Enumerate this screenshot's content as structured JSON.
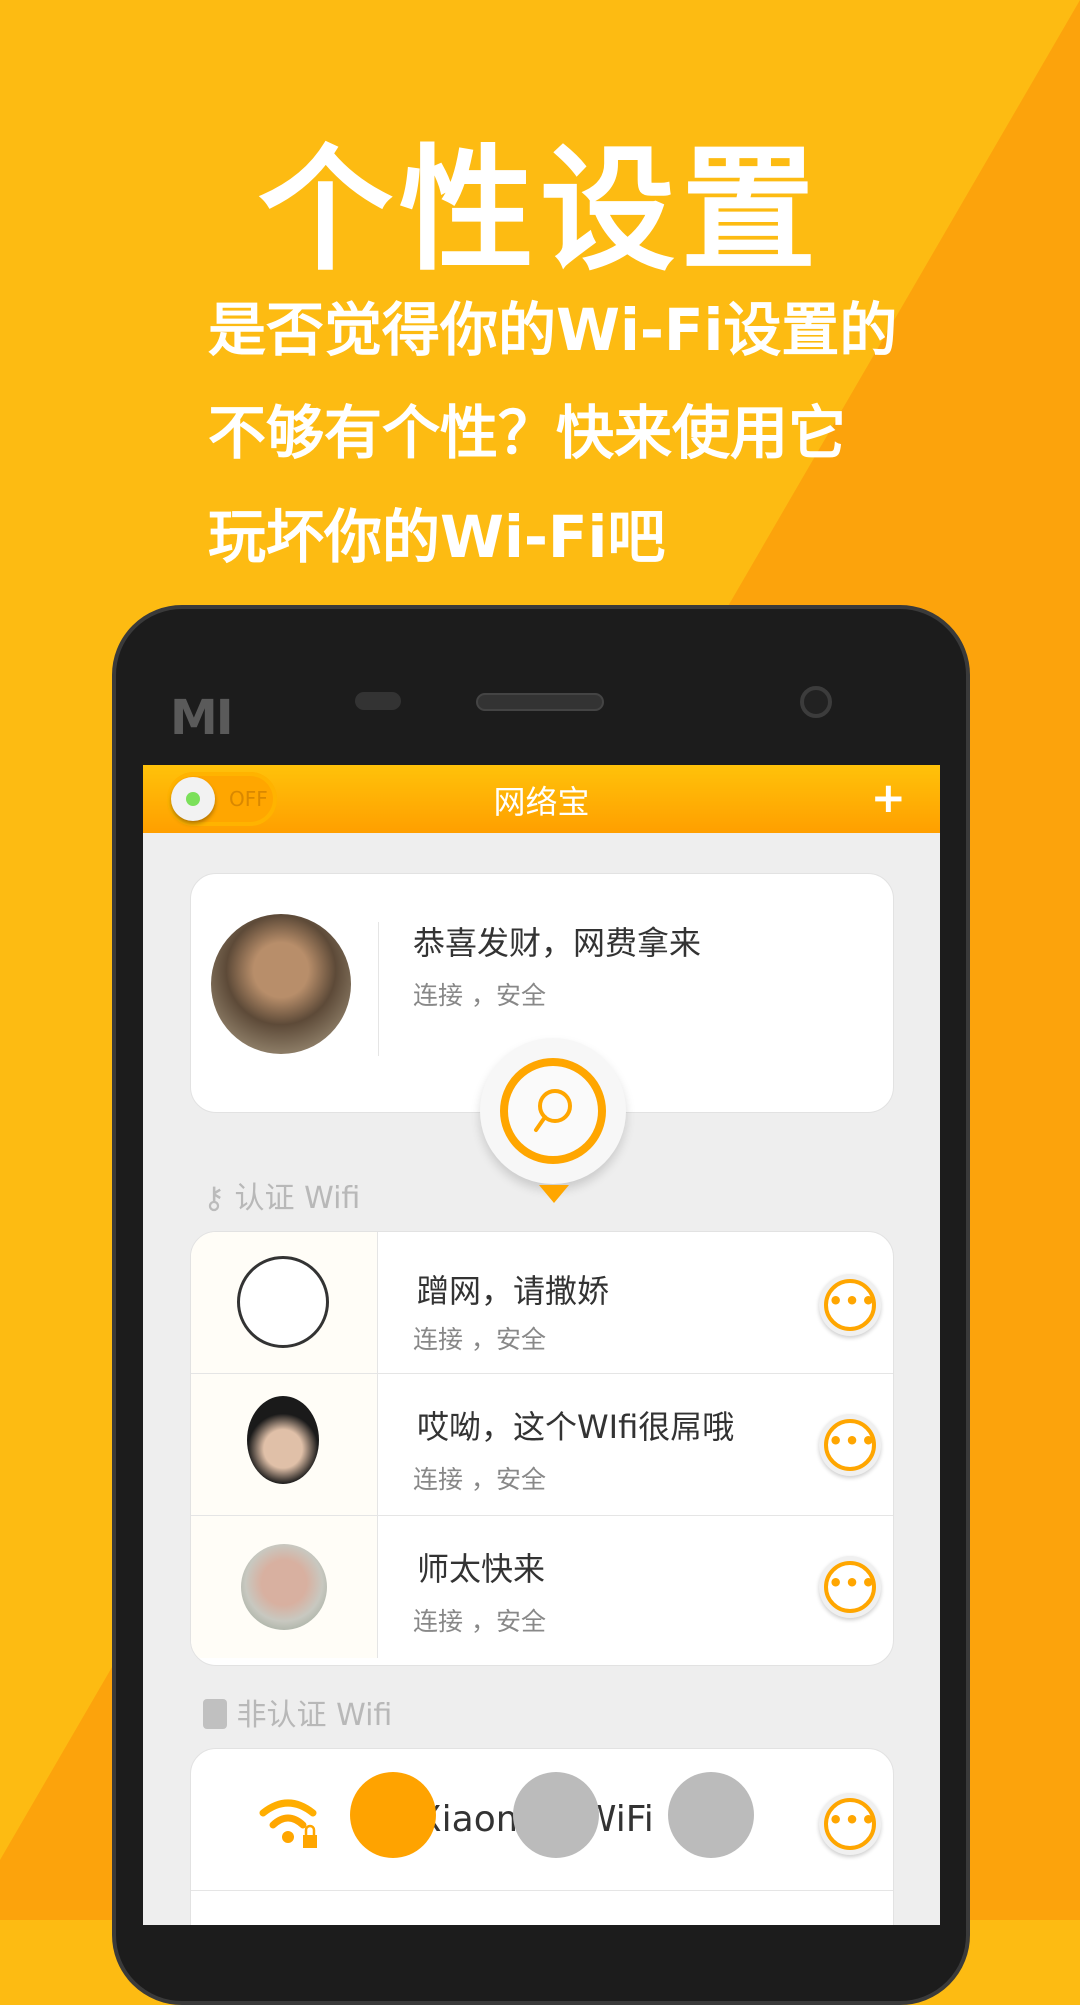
{
  "promo": {
    "headline": "个性设置",
    "lines": [
      "是否觉得你的Wi-Fi设置的",
      "不够有个性？快来使用它",
      "玩坏你的Wi-Fi吧"
    ]
  },
  "colors": {
    "background_yellow": "#fdbb12",
    "background_orange": "#fca30c",
    "accent": "#ffa600"
  },
  "phone": {
    "brand": "MI"
  },
  "app": {
    "title": "网络宝",
    "toggle": {
      "label": "OFF",
      "state": "off"
    },
    "add_icon": "plus-icon",
    "current": {
      "name": "恭喜发财，网费拿来",
      "status": "连接 ，安全"
    },
    "certified_section": "认证 Wifi",
    "certified": [
      {
        "name": "蹭网，请撒娇",
        "status": "连接 ，安全"
      },
      {
        "name": "哎呦，这个WIfi很屌哦",
        "status": "连接 ，安全"
      },
      {
        "name": "师太快来",
        "status": "连接 ，安全"
      }
    ],
    "uncertified_section": "非认证 Wifi",
    "uncertified": [
      {
        "name": "Xiaomi's WiFi"
      }
    ],
    "more_label": "•••"
  },
  "page_indicator": {
    "total": 3,
    "active": 1
  }
}
